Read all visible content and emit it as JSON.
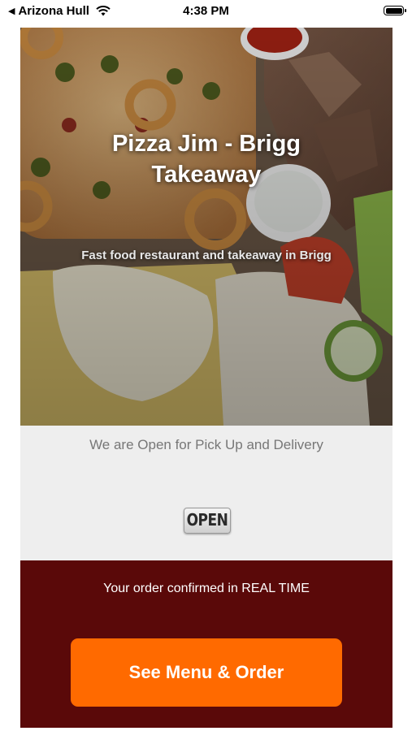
{
  "status_bar": {
    "back_label": "Arizona Hull",
    "time": "4:38 PM"
  },
  "hero": {
    "title": "Pizza Jim - Brigg Takeaway",
    "subtitle": "Fast food restaurant and takeaway in Brigg"
  },
  "availability": {
    "message": "We are Open for Pick Up and Delivery",
    "sign_text": "OPEN"
  },
  "ordering": {
    "realtime_text": "Your order confirmed in REAL TIME",
    "button_label": "See Menu & Order"
  },
  "colors": {
    "order_panel": "#5a0909",
    "order_button": "#ff6a00",
    "open_panel": "#eeeeee"
  }
}
